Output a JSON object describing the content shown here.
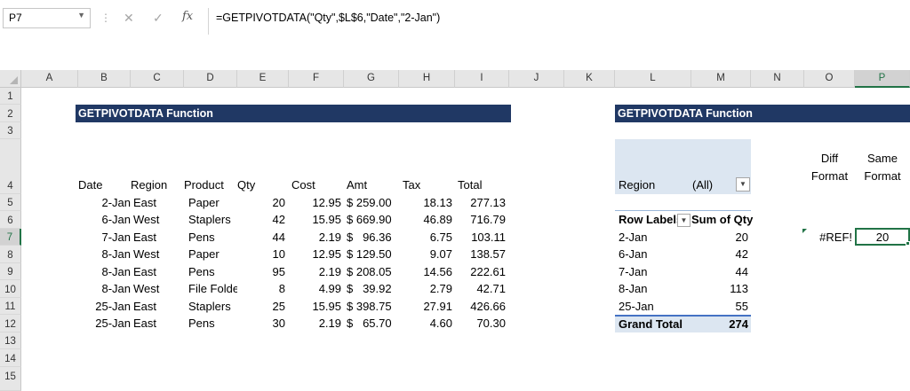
{
  "formula_bar": {
    "name_box": "P7",
    "formula": "=GETPIVOTDATA(\"Qty\",$L$6,\"Date\",\"2-Jan\")"
  },
  "icons": {
    "cancel": "✕",
    "enter": "✓",
    "fx": "fx",
    "dropdown": "▼"
  },
  "columns": [
    "A",
    "B",
    "C",
    "D",
    "E",
    "F",
    "G",
    "H",
    "I",
    "J",
    "K",
    "L",
    "M",
    "N",
    "O",
    "P"
  ],
  "rows": [
    "1",
    "2",
    "3",
    "4",
    "5",
    "6",
    "7",
    "8",
    "9",
    "10",
    "11",
    "12",
    "13",
    "14",
    "15"
  ],
  "sheet": {
    "left_banner": "GETPIVOTDATA Function",
    "right_banner": "GETPIVOTDATA Function",
    "table_headers": [
      "Date",
      "Region",
      "Product",
      "Qty",
      "Cost",
      "Amt",
      "Tax",
      "Total"
    ],
    "table_rows": [
      [
        "2-Jan",
        "East",
        "Paper",
        "20",
        "12.95",
        "$ 259.00",
        "18.13",
        "277.13"
      ],
      [
        "6-Jan",
        "West",
        "Staplers",
        "42",
        "15.95",
        "$ 669.90",
        "46.89",
        "716.79"
      ],
      [
        "7-Jan",
        "East",
        "Pens",
        "44",
        "2.19",
        "$   96.36",
        "6.75",
        "103.11"
      ],
      [
        "8-Jan",
        "West",
        "Paper",
        "10",
        "12.95",
        "$ 129.50",
        "9.07",
        "138.57"
      ],
      [
        "8-Jan",
        "East",
        "Pens",
        "95",
        "2.19",
        "$ 208.05",
        "14.56",
        "222.61"
      ],
      [
        "8-Jan",
        "West",
        "File Folde",
        "8",
        "4.99",
        "$   39.92",
        "2.79",
        "42.71"
      ],
      [
        "25-Jan",
        "East",
        "Staplers",
        "25",
        "15.95",
        "$ 398.75",
        "27.91",
        "426.66"
      ],
      [
        "25-Jan",
        "East",
        "Pens",
        "30",
        "2.19",
        "$   65.70",
        "4.60",
        "70.30"
      ]
    ],
    "pivot": {
      "filter_label": "Region",
      "filter_value": "(All)",
      "row_labels_header": "Row Labels",
      "sum_header": "Sum of Qty",
      "rows": [
        [
          "2-Jan",
          "20"
        ],
        [
          "6-Jan",
          "42"
        ],
        [
          "7-Jan",
          "44"
        ],
        [
          "8-Jan",
          "113"
        ],
        [
          "25-Jan",
          "55"
        ]
      ],
      "grand_total_label": "Grand Total",
      "grand_total_value": "274"
    },
    "diff_format_line1": "Diff",
    "diff_format_line2": "Format",
    "same_format_line1": "Same",
    "same_format_line2": "Format",
    "o7_value": "#REF!",
    "p7_value": "20"
  }
}
